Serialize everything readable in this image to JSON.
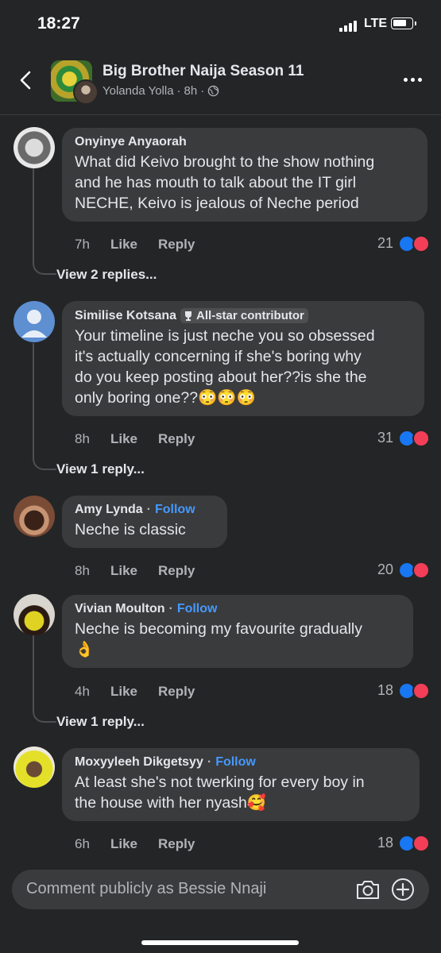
{
  "status_bar": {
    "time": "18:27",
    "network": "LTE"
  },
  "header": {
    "title": "Big Brother Naija Season 11",
    "author": "Yolanda Yolla",
    "separator1": "·",
    "age": "8h",
    "separator2": "·"
  },
  "comments": [
    {
      "name": "Onyinye Anyaorah",
      "lines": [
        "What did Keivo brought to the show nothing",
        "and he has mouth to talk about the IT girl",
        "NECHE, Keivo is jealous of Neche period"
      ],
      "time": "7h",
      "like": "Like",
      "reply": "Reply",
      "reactions": "21",
      "view_replies": "View 2 replies..."
    },
    {
      "name": "Similise Kotsana",
      "badge": "All-star contributor",
      "lines": [
        "Your timeline is just neche you so obsessed",
        "it's actually concerning if she's boring why",
        "do you keep posting about her??is she the",
        "only boring one??😳😳😳"
      ],
      "time": "8h",
      "like": "Like",
      "reply": "Reply",
      "reactions": "31",
      "view_replies": "View 1 reply..."
    },
    {
      "name": "Amy Lynda",
      "dot": "·",
      "follow": "Follow",
      "lines": [
        "Neche is classic"
      ],
      "time": "8h",
      "like": "Like",
      "reply": "Reply",
      "reactions": "20"
    },
    {
      "name": "Vivian Moulton",
      "dot": "·",
      "follow": "Follow",
      "lines": [
        "Neche is becoming my favourite gradually",
        "👌"
      ],
      "time": "4h",
      "like": "Like",
      "reply": "Reply",
      "reactions": "18",
      "view_replies": "View 1 reply..."
    },
    {
      "name": "Moxyyleeh Dikgetsyy",
      "dot": "·",
      "follow": "Follow",
      "lines": [
        "At least she's not twerking for every boy in",
        "the house with her nyash🥰"
      ],
      "time": "6h",
      "like": "Like",
      "reply": "Reply",
      "reactions": "18"
    }
  ],
  "composer": {
    "placeholder": "Comment publicly as Bessie Nnaji"
  },
  "icons": [
    "back-icon",
    "globe-icon",
    "more-icon",
    "trophy-icon",
    "like-reaction-icon",
    "love-reaction-icon",
    "camera-icon",
    "plus-icon"
  ],
  "colors": {
    "background": "#242526",
    "bubble": "#3a3b3c",
    "follow": "#4599ff",
    "like": "#1877f2",
    "love": "#f33e58"
  }
}
